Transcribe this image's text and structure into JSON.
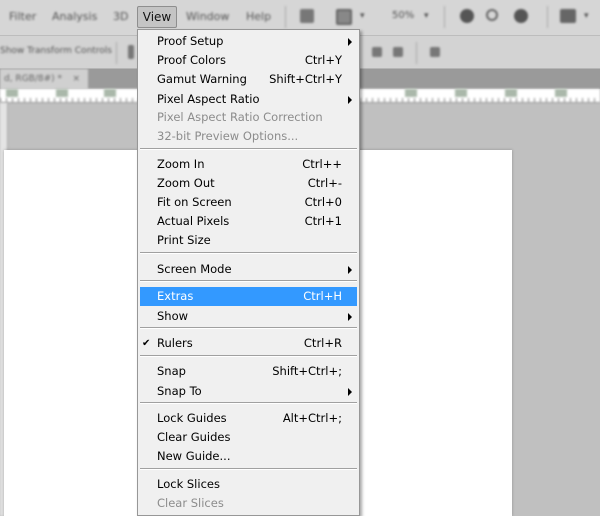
{
  "menubar": {
    "items": [
      {
        "label": "Filter"
      },
      {
        "label": "Analysis"
      },
      {
        "label": "3D"
      },
      {
        "label": "View"
      },
      {
        "label": "Window"
      },
      {
        "label": "Help"
      }
    ],
    "zoom_value": "50%"
  },
  "options_bar": {
    "label": "Show Transform Controls"
  },
  "document_tab": {
    "label": "d, RGB/8#) *",
    "close": "×"
  },
  "view_menu": {
    "groups": [
      [
        {
          "label": "Proof Setup",
          "shortcut": "",
          "submenu": true,
          "enabled": true
        },
        {
          "label": "Proof Colors",
          "shortcut": "Ctrl+Y",
          "submenu": false,
          "enabled": true
        },
        {
          "label": "Gamut Warning",
          "shortcut": "Shift+Ctrl+Y",
          "submenu": false,
          "enabled": true
        },
        {
          "label": "Pixel Aspect Ratio",
          "shortcut": "",
          "submenu": true,
          "enabled": true
        },
        {
          "label": "Pixel Aspect Ratio Correction",
          "shortcut": "",
          "submenu": false,
          "enabled": false
        },
        {
          "label": "32-bit Preview Options...",
          "shortcut": "",
          "submenu": false,
          "enabled": false
        }
      ],
      [
        {
          "label": "Zoom In",
          "shortcut": "Ctrl++",
          "submenu": false,
          "enabled": true
        },
        {
          "label": "Zoom Out",
          "shortcut": "Ctrl+-",
          "submenu": false,
          "enabled": true
        },
        {
          "label": "Fit on Screen",
          "shortcut": "Ctrl+0",
          "submenu": false,
          "enabled": true
        },
        {
          "label": "Actual Pixels",
          "shortcut": "Ctrl+1",
          "submenu": false,
          "enabled": true
        },
        {
          "label": "Print Size",
          "shortcut": "",
          "submenu": false,
          "enabled": true
        }
      ],
      [
        {
          "label": "Screen Mode",
          "shortcut": "",
          "submenu": true,
          "enabled": true
        }
      ],
      [
        {
          "label": "Extras",
          "shortcut": "Ctrl+H",
          "submenu": false,
          "enabled": true,
          "highlighted": true
        },
        {
          "label": "Show",
          "shortcut": "",
          "submenu": true,
          "enabled": true
        }
      ],
      [
        {
          "label": "Rulers",
          "shortcut": "Ctrl+R",
          "submenu": false,
          "enabled": true,
          "checked": true,
          "check_mark": "✔"
        }
      ],
      [
        {
          "label": "Snap",
          "shortcut": "Shift+Ctrl+;",
          "submenu": false,
          "enabled": true
        },
        {
          "label": "Snap To",
          "shortcut": "",
          "submenu": true,
          "enabled": true
        }
      ],
      [
        {
          "label": "Lock Guides",
          "shortcut": "Alt+Ctrl+;",
          "submenu": false,
          "enabled": true
        },
        {
          "label": "Clear Guides",
          "shortcut": "",
          "submenu": false,
          "enabled": true
        },
        {
          "label": "New Guide...",
          "shortcut": "",
          "submenu": false,
          "enabled": true
        }
      ],
      [
        {
          "label": "Lock Slices",
          "shortcut": "",
          "submenu": false,
          "enabled": true
        },
        {
          "label": "Clear Slices",
          "shortcut": "",
          "submenu": false,
          "enabled": false
        }
      ]
    ]
  },
  "colors": {
    "highlight": "#3399ff",
    "menu_bg": "#f0f0f0",
    "disabled_text": "#8c8c8c",
    "canvas_bg": "#c0c0c0"
  }
}
